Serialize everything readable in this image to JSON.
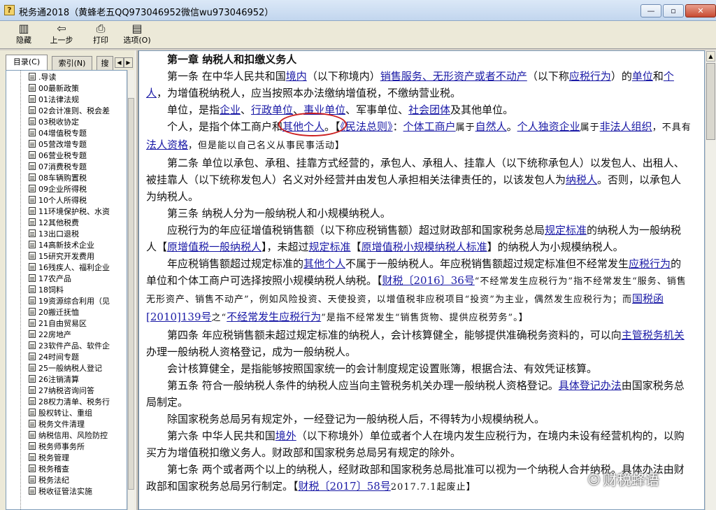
{
  "window": {
    "title": "税务通2018（黄蜂老五QQ973046952微信wu973046952）",
    "minimize": "—",
    "maximize": "▫",
    "close": "✕"
  },
  "toolbar": [
    {
      "label": "隐藏",
      "icon": "hide-icon"
    },
    {
      "label": "上一步",
      "icon": "back-arrow-icon"
    },
    {
      "label": "打印",
      "icon": "printer-icon"
    },
    {
      "label": "选项(O)",
      "icon": "options-icon"
    }
  ],
  "tabs": [
    {
      "label": "目录(C)",
      "active": true
    },
    {
      "label": "索引(N)",
      "active": false
    },
    {
      "label": "搜",
      "active": false
    }
  ],
  "tree": [
    ".导读",
    "00最新政策",
    "01法律法规",
    "02会计准则、税会差",
    "03税收协定",
    "04增值税专题",
    "05营改增专题",
    "06营业税专题",
    "07消费税专题",
    "08车辆购置税",
    "09企业所得税",
    "10个人所得税",
    "11环境保护税、水资",
    "12其他税费",
    "13出口退税",
    "14高新技术企业",
    "15研究开发费用",
    "16残疾人、福利企业",
    "17农产品",
    "18饲料",
    "19资源综合利用（见",
    "20搬迁抚恤",
    "21自由贸易区",
    "22房地产",
    "23软件产品、软件企",
    "24时间专题",
    "25一般纳税人登记",
    "26注销清算",
    "27纳税咨询问答",
    "28权力清单、税务行",
    "股权转让、重组",
    "税务文件清理",
    "纳税信用、风险防控",
    "税务师事务所",
    "税务管理",
    "税务稽查",
    "税务法纪",
    "税收征管法实施"
  ],
  "doc": {
    "chapter": "第一章  纳税人和扣缴义务人",
    "a1_1": "第一条 在中华人民共和国",
    "a1_l1": "境内",
    "a1_2": "（以下称境内）",
    "a1_l2": "销售服务、无形资产或者不动产",
    "a1_3": "（以下称",
    "a1_l3": "应税行为",
    "a1_4": "）的",
    "a1_l4": "单位",
    "a1_5": "和",
    "a1_l5": "个人",
    "a1_6": "，为增值税纳税人，应当按照本办法缴纳增值税，不缴纳营业税。",
    "u_1": "单位，是指",
    "u_l1": "企业",
    "u_2": "、",
    "u_l2": "行政单位",
    "u_3": "、",
    "u_l3": "事业单位",
    "u_4": "、军事单位、",
    "u_l4": "社会团体",
    "u_5": "及其他单位。",
    "p_1": "个人，是指个体工商户和",
    "p_l1": "其他个人",
    "p_2": "。【",
    "p_l2": "《民法总则》",
    "p_3": "：",
    "p_l3": "个体工商户",
    "p_4": "属于",
    "p_l4": "自然人",
    "p_5": "。",
    "p_l5": "个人独资企业",
    "p_6": "属于",
    "p_l6": "非法人组织",
    "p_7": "，不具有",
    "p_l7": "法人资格",
    "p_8": "，但是能以自己名义从事民事活动】",
    "a2_1": "第二条 单位以承包、承租、挂靠方式经营的，承包人、承租人、挂靠人（以下统称承包人）以发包人、出租人、被挂靠人（以下统称发包人）名义对外经营并由发包人承担相关法律责任的，以该发包人为",
    "a2_l1": "纳税人",
    "a2_2": "。否则，以承包人为纳税人。",
    "a3": "第三条 纳税人分为一般纳税人和小规模纳税人。",
    "s_1": "应税行为的年应征增值税销售额（以下称应税销售额）超过财政部和国家税务总局",
    "s_l1": "规定标准",
    "s_2": "的纳税人为一般纳税人【",
    "s_l2": "原增值税一般纳税人",
    "s_3": "】，未超过",
    "s_l3": "规定标准",
    "s_4": "【",
    "s_l4": "原增值税小规模纳税人标准",
    "s_5": "】的纳税人为小规模纳税人。",
    "y_1": "年应税销售额超过规定标准的",
    "y_l1": "其他个人",
    "y_2": "不属于一般纳税人。年应税销售额超过规定标准但不经常发生",
    "y_l2": "应税行为",
    "y_3": "的单位和个体工商户可选择按照小规模纳税人纳税。【",
    "y_l3": "财税〔2016〕36号",
    "y_4": "“不经常发生应税行为”指不经常发生“服务、销售无形资产、销售不动产”，例如风险投资、天使投资，以增值税非应税项目“投资”为主业，偶然发生应税行为；而",
    "y_l4": "国税函[2010]139号",
    "y_5": "之“",
    "y_l5": "不经常发生应税行为",
    "y_6": "”是指不经常发生“销售货物、提供应税劳务”。】",
    "a4_1": "第四条 年应税销售额未超过规定标准的纳税人，会计核算健全，能够提供准确税务资料的，可以向",
    "a4_l1": "主管税务机关",
    "a4_2": "办理一般纳税人资格登记，成为一般纳税人。",
    "acc": "会计核算健全，是指能够按照国家统一的会计制度规定设置账簿，根据合法、有效凭证核算。",
    "a5_1": "第五条 符合一般纳税人条件的纳税人应当向主管税务机关办理一般纳税人资格登记。",
    "a5_l1": "具体登记办法",
    "a5_2": "由国家税务总局制定。",
    "ex": "除国家税务总局另有规定外，一经登记为一般纳税人后，不得转为小规模纳税人。",
    "a6_1": "第六条 中华人民共和国",
    "a6_l1": "境外",
    "a6_2": "（以下称境外）单位或者个人在境内发生应税行为，在境内未设有经营机构的，以购买方为增值税扣缴义务人。财政部和国家税务总局另有规定的除外。",
    "a7_1": "第七条 两个或者两个以上的纳税人，经财政部和国家税务总局批准可以视为一个纳税人合并纳税。具体办法由财政部和国家税务总局另行制定。【",
    "a7_l1": "财税〔2017〕58号",
    "a7_2": "2017.7.1起废止】"
  },
  "watermark": "财税蜂语"
}
